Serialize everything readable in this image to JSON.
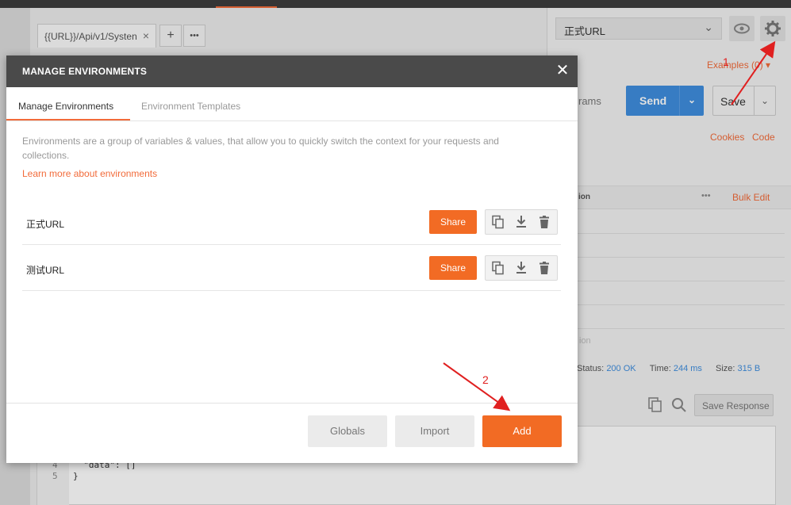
{
  "background": {
    "tab_label": "{{URL}}/Api/v1/Systen",
    "tab_close": "×",
    "new_tab": "+",
    "tab_menu": "•••",
    "environment_select": "正式URL",
    "examples_label": "Examples (0)",
    "send_label": "Send",
    "save_label": "Save",
    "params_label": "rams",
    "cookies_label": "Cookies",
    "code_label": "Code",
    "table_col": "ion",
    "table_menu": "•••",
    "bulk_edit_label": "Bulk Edit",
    "description_placeholder": "ion",
    "status_label": "Status:",
    "status_value": "200 OK",
    "time_label": "Time:",
    "time_value": "244 ms",
    "size_label": "Size:",
    "size_value": "315 B",
    "save_response_label": "Save Response",
    "code_lines": [
      {
        "no": "4",
        "text": "  \"data\": []"
      },
      {
        "no": "5",
        "text": "}"
      }
    ]
  },
  "modal": {
    "title": "MANAGE ENVIRONMENTS",
    "tabs": [
      "Manage Environments",
      "Environment Templates"
    ],
    "description": "Environments are a group of variables & values, that allow you to quickly switch the context for your requests and collections.",
    "learn_more": "Learn more about environments",
    "environments": [
      {
        "name": "正式URL",
        "share": "Share"
      },
      {
        "name": "测试URL",
        "share": "Share"
      }
    ],
    "footer": {
      "globals": "Globals",
      "import": "Import",
      "add": "Add"
    }
  },
  "annotations": {
    "step1": "1",
    "step2": "2",
    "color": "#e02020"
  },
  "colors": {
    "accent": "#f26b24",
    "send_blue": "#3f8ede",
    "header_dark": "#4a4a4a"
  }
}
